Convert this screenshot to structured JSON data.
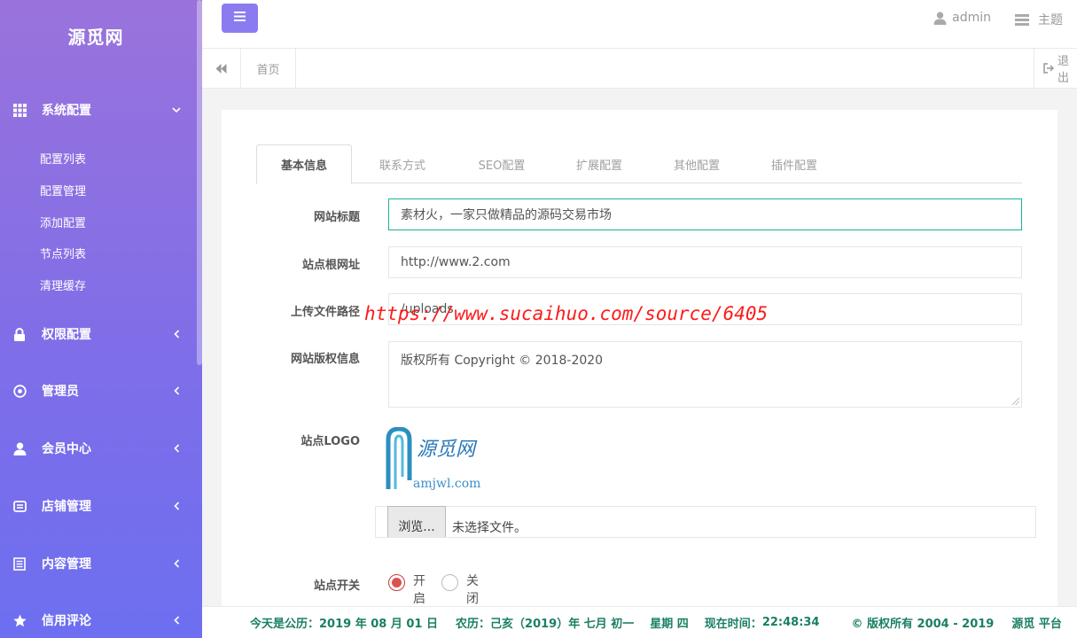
{
  "sidebar": {
    "brand": "源觅网",
    "groups": [
      {
        "label": "系统配置",
        "icon": "grid-icon",
        "expanded": true
      },
      {
        "label": "权限配置",
        "icon": "lock-icon"
      },
      {
        "label": "管理员",
        "icon": "target-icon"
      },
      {
        "label": "会员中心",
        "icon": "user-icon"
      },
      {
        "label": "店铺管理",
        "icon": "store-icon"
      },
      {
        "label": "内容管理",
        "icon": "list-icon"
      },
      {
        "label": "信用评论",
        "icon": "star-icon"
      }
    ],
    "submenu": [
      "配置列表",
      "配置管理",
      "添加配置",
      "节点列表",
      "清理缓存"
    ]
  },
  "topbar": {
    "user": "admin",
    "theme": "主题"
  },
  "tabbar": {
    "home": "首页",
    "exit": "退出"
  },
  "form": {
    "tabs": [
      "基本信息",
      "联系方式",
      "SEO配置",
      "扩展配置",
      "其他配置",
      "插件配置"
    ],
    "active_tab": "基本信息",
    "fields": {
      "site_title_label": "网站标题",
      "site_title_value": "素材火，一家只做精品的源码交易市场",
      "site_url_label": "站点根网址",
      "site_url_value": "http://www.2.com",
      "upload_path_label": "上传文件路径",
      "upload_path_value": "/uploads",
      "copyright_label": "网站版权信息",
      "copyright_value": "版权所有 Copyright © 2018-2020",
      "logo_label": "站点LOGO",
      "file_button": "浏览...",
      "file_status": "未选择文件。",
      "switch_label": "站点开关",
      "switch_on": "开启",
      "switch_off": "关闭",
      "switch_value": "开启"
    },
    "watermark": "https://www.sucaihuo.com/source/6405"
  },
  "logo": {
    "cn_text": "源觅网",
    "en_text": "amjwl.com"
  },
  "footer": {
    "date_label": "今天是公历：",
    "date_value": "2019 年 08 月 01 日",
    "lunar_label": "农历：",
    "lunar_value": "己亥（2019）年 七月 初一",
    "weekday": "星期 四",
    "time_label": "现在时间：",
    "time_value": "22:48:34",
    "copyright": "© 版权所有 2004 - 2019",
    "platform": "源觅 平台"
  },
  "colors": {
    "sidebar_top": "#9a72dc",
    "sidebar_bottom": "#6d6ff0",
    "toggle_button": "#8a7cf0",
    "focus_border": "#1ab394",
    "footer_text": "#1a7f64",
    "watermark": "#ff1a1a",
    "radio_on": "#d9534f"
  }
}
